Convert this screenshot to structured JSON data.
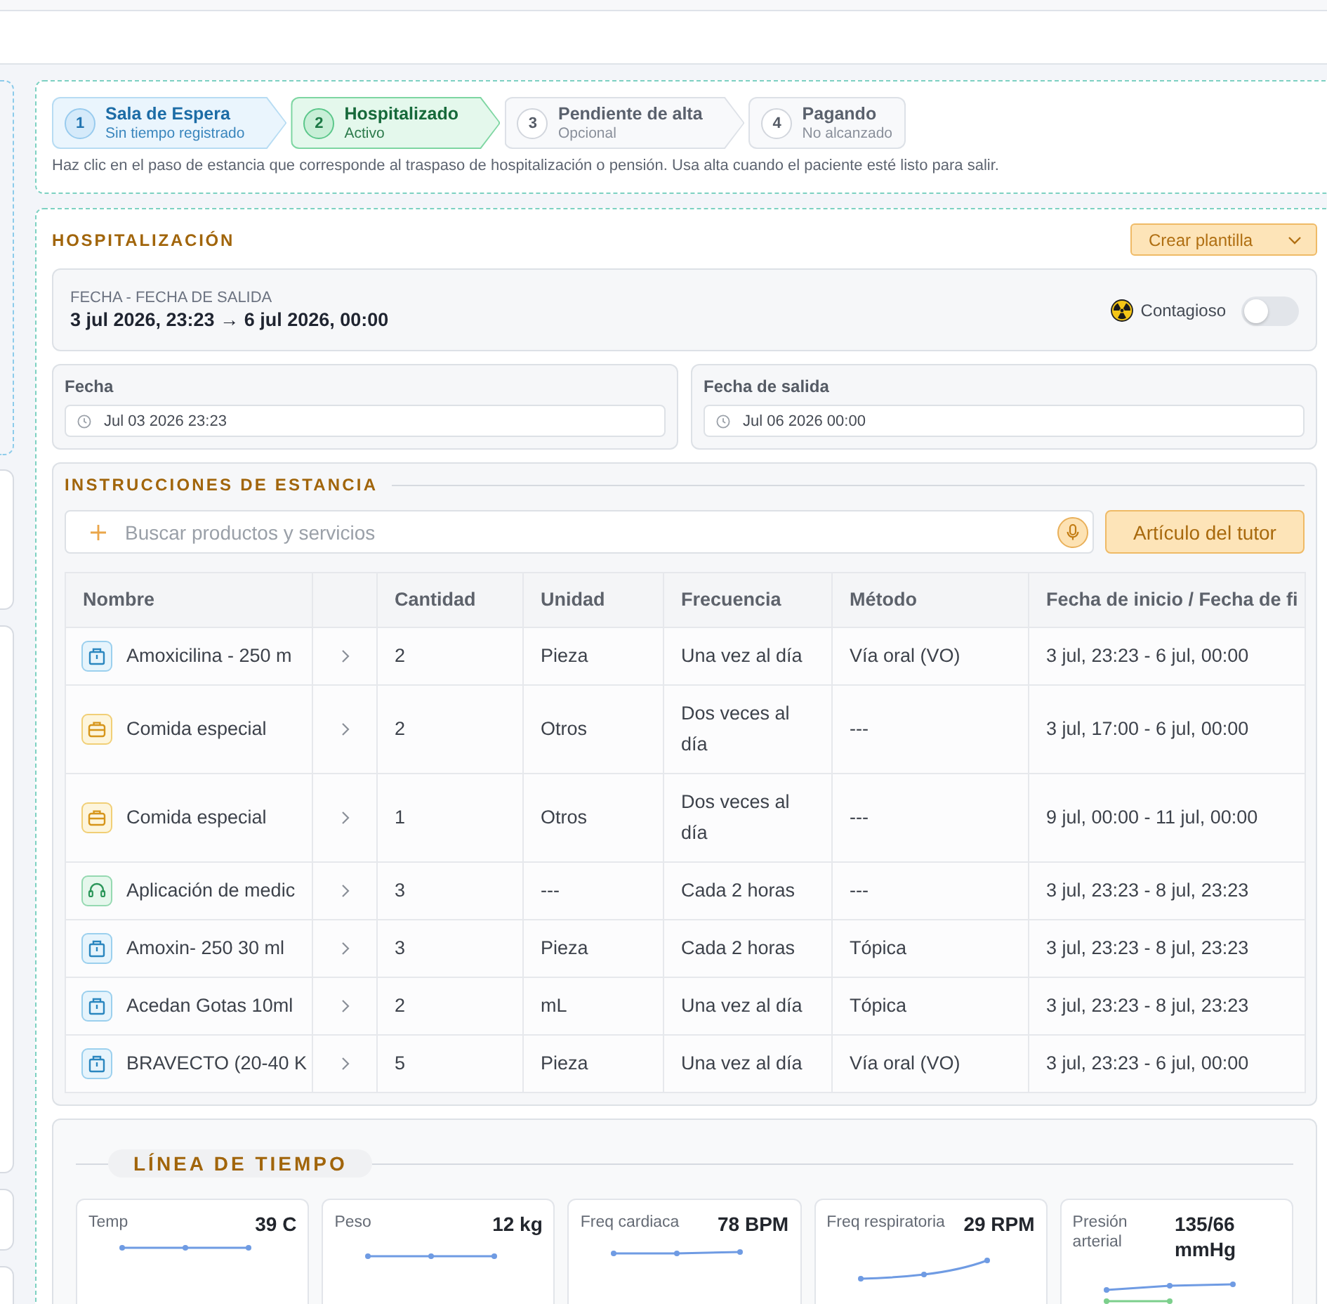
{
  "steps": [
    {
      "number": "1",
      "title": "Sala de Espera",
      "subtitle": "Sin tiempo registrado",
      "completed": true,
      "selected": false
    },
    {
      "number": "2",
      "title": "Hospitalizado",
      "subtitle": "Activo",
      "completed": false,
      "selected": true
    },
    {
      "number": "3",
      "title": "Pendiente de alta",
      "subtitle": "Opcional",
      "completed": false,
      "selected": false
    },
    {
      "number": "4",
      "title": "Pagando",
      "subtitle": "No alcanzado",
      "completed": false,
      "selected": false
    }
  ],
  "steps_hint": "Haz clic en el paso de estancia que corresponde al traspaso de hospitalización o pensión. Usa alta cuando el paciente esté listo para salir.",
  "hospitalization": {
    "title": "HOSPITALIZACIÓN",
    "template_button": "Crear plantilla",
    "range_label": "FECHA - FECHA DE SALIDA",
    "range": "3 jul 2026, 23:23 → 6 jul 2026, 00:00",
    "contagious": {
      "label": "Contagioso",
      "on": false
    },
    "date_fields": [
      {
        "label": "Fecha",
        "value": "Jul 03 2026 23:23"
      },
      {
        "label": "Fecha de salida",
        "value": "Jul 06 2026 00:00"
      }
    ]
  },
  "instructions": {
    "title": "INSTRUCCIONES DE ESTANCIA",
    "search": {
      "placeholder": "Buscar productos y servicios"
    },
    "tutor_button": "Artículo del tutor",
    "table": {
      "columns": [
        "Nombre",
        "Cantidad",
        "Unidad",
        "Frecuencia",
        "Método",
        "Fecha de inicio / Fecha de fi"
      ],
      "rows": [
        {
          "kind": "medicine",
          "name": "Amoxicilina - 250 m",
          "quantity": "2",
          "unit": "Pieza",
          "frequency": "Una vez al día",
          "method": "Vía oral (VO)",
          "dates": "3 jul, 23:23 - 6 jul, 00:00"
        },
        {
          "kind": "food",
          "name": "Comida especial",
          "quantity": "2",
          "unit": "Otros",
          "frequency": "Dos veces al día",
          "method": "---",
          "dates": "3 jul, 17:00 - 6 jul, 00:00"
        },
        {
          "kind": "food",
          "name": "Comida especial",
          "quantity": "1",
          "unit": "Otros",
          "frequency": "Dos veces al día",
          "method": "---",
          "dates": "9 jul, 00:00 - 11 jul, 00:00"
        },
        {
          "kind": "service",
          "name": "Aplicación de medic",
          "quantity": "3",
          "unit": "---",
          "frequency": "Cada 2 horas",
          "method": "---",
          "dates": "3 jul, 23:23 - 8 jul, 23:23"
        },
        {
          "kind": "medicine",
          "name": "Amoxin- 250 30 ml",
          "quantity": "3",
          "unit": "Pieza",
          "frequency": "Cada 2 horas",
          "method": "Tópica",
          "dates": "3 jul, 23:23 - 8 jul, 23:23"
        },
        {
          "kind": "medicine",
          "name": "Acedan Gotas 10ml",
          "quantity": "2",
          "unit": "mL",
          "frequency": "Una vez al día",
          "method": "Tópica",
          "dates": "3 jul, 23:23 - 8 jul, 23:23"
        },
        {
          "kind": "medicine",
          "name": "BRAVECTO (20-40 K",
          "quantity": "5",
          "unit": "Pieza",
          "frequency": "Una vez al día",
          "method": "Vía oral (VO)",
          "dates": "3 jul, 23:23 - 6 jul, 00:00"
        }
      ]
    }
  },
  "timeline": {
    "title": "LÍNEA DE TIEMPO",
    "vitals": [
      {
        "label": "Temp",
        "value": "39 C"
      },
      {
        "label": "Peso",
        "value": "12 kg"
      },
      {
        "label": "Freq cardiaca",
        "value": "78 BPM"
      },
      {
        "label": "Freq respiratoria",
        "value": "29 RPM"
      },
      {
        "label": "Presión arterial",
        "value": "135/66 mmHg"
      }
    ]
  }
}
